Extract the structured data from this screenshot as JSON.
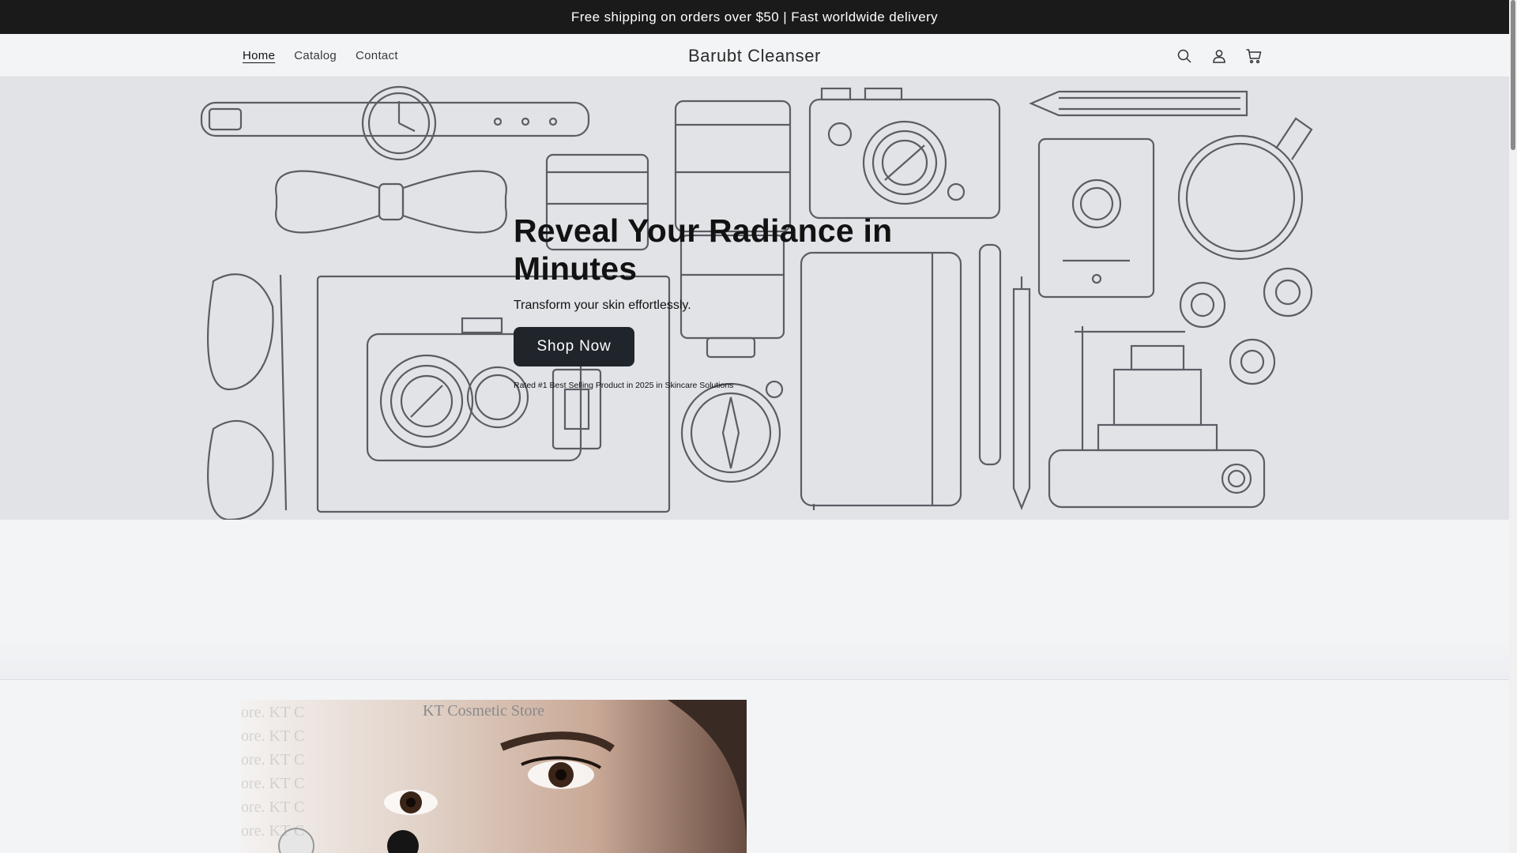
{
  "announcement": {
    "text": "Free shipping on orders over $50 | Fast worldwide delivery"
  },
  "header": {
    "nav": [
      {
        "label": "Home",
        "active": true
      },
      {
        "label": "Catalog",
        "active": false
      },
      {
        "label": "Contact",
        "active": false
      }
    ],
    "brand": "Barubt Cleanser",
    "icons": [
      "search-icon",
      "account-icon",
      "cart-icon"
    ]
  },
  "hero": {
    "title": "Reveal Your Radiance in Minutes",
    "subtitle": "Transform your skin effortlessly.",
    "button": "Shop Now",
    "rated": "Rated #1 Best Selling Product in 2025 in Skincare Solutions"
  },
  "product_image": {
    "watermark": "KT Cosmetic Store"
  },
  "colors": {
    "announcement_bg": "#1a1a1a",
    "hero_bg": "#e2e3e7",
    "button_bg": "#1f252b",
    "page_bg": "#f3f4f6"
  }
}
